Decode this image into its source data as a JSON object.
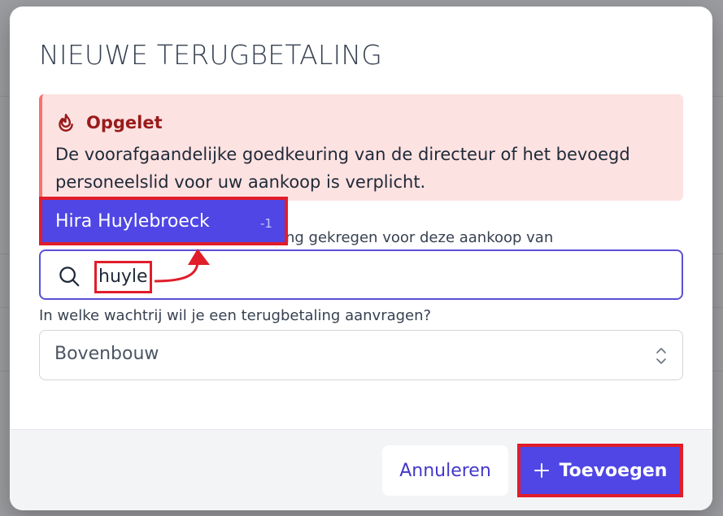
{
  "modal": {
    "title": "NIEUWE TERUGBETALING"
  },
  "alert": {
    "icon": "fire-icon",
    "title": "Opgelet",
    "text": "De voorafgaandelijke goedkeuring van de directeur of het bevoegd personeelslid voor uw aankoop is verplicht.",
    "colors": {
      "background": "#fde2e2",
      "title": "#991b1b"
    }
  },
  "approval_field": {
    "label_visible": "ing gekregen voor deze aankoop van",
    "search_value": "huyle",
    "search_icon": "search-icon"
  },
  "dropdown": {
    "option_name": "Hira Huylebroeck",
    "option_count": "-1"
  },
  "queue_field": {
    "label": "In welke wachtrij wil je een terugbetaling aanvragen?",
    "selected": "Bovenbouw",
    "icon": "chevron-up-down-icon"
  },
  "footer": {
    "cancel_label": "Annuleren",
    "add_label": "Toevoegen",
    "add_icon": "plus-icon"
  },
  "colors": {
    "accent": "#4f46e5",
    "highlight": "#e11d2a"
  }
}
